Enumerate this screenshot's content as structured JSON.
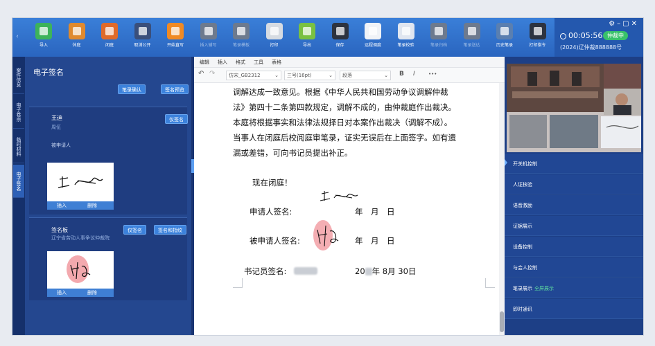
{
  "toolbar": {
    "buttons": [
      {
        "label": "导入",
        "icon": "import-icon",
        "color": "#3db35a",
        "enabled": true
      },
      {
        "label": "休庭",
        "icon": "recess-icon",
        "color": "#e08a2e",
        "enabled": true
      },
      {
        "label": "闭庭",
        "icon": "close-court-icon",
        "color": "#e06a2a",
        "enabled": true
      },
      {
        "label": "取消公开",
        "icon": "cancel-public-icon",
        "color": "#3a4f7a",
        "enabled": true
      },
      {
        "label": "开始直写",
        "icon": "start-write-icon",
        "color": "#f08a24",
        "enabled": true
      },
      {
        "label": "插入辅写",
        "icon": "insert-assist-icon",
        "color": "#6d7a8e",
        "enabled": false
      },
      {
        "label": "笔录模板",
        "icon": "transcript-template-icon",
        "color": "#6d7a8e",
        "enabled": false
      },
      {
        "label": "打印",
        "icon": "print-icon",
        "color": "#d6dbe2",
        "enabled": true
      },
      {
        "label": "导出",
        "icon": "export-icon",
        "color": "#7ac142",
        "enabled": true
      },
      {
        "label": "保存",
        "icon": "save-icon",
        "color": "#2d3340",
        "enabled": true
      },
      {
        "label": "远程调度",
        "icon": "remote-dispatch-icon",
        "color": "#f0f3f7",
        "enabled": true
      },
      {
        "label": "笔录校验",
        "icon": "transcript-check-icon",
        "color": "#e0e6f0",
        "enabled": true
      },
      {
        "label": "笔录归档",
        "icon": "transcript-archive-icon",
        "color": "#6d7a8e",
        "enabled": false
      },
      {
        "label": "笔录送达",
        "icon": "transcript-deliver-icon",
        "color": "#6d7a8e",
        "enabled": false
      },
      {
        "label": "历史笔录",
        "icon": "history-transcript-icon",
        "color": "#5a7fb0",
        "enabled": true
      },
      {
        "label": "打印指令",
        "icon": "print-command-icon",
        "color": "#2d3340",
        "enabled": true
      }
    ],
    "timer": "00:05:56",
    "status": "仲裁中",
    "case_no": "(2024)辽仲裁888888号"
  },
  "vtabs": [
    "案件信息",
    "电子卷宗",
    "临时材料",
    "电子签名"
  ],
  "left": {
    "title": "电子签名",
    "confirm_btn": "笔录确认",
    "preview_btn": "签名预览",
    "signer1": {
      "name": "王迪",
      "role": "周伍",
      "party": "被申请人",
      "sign_btn": "仅签名",
      "insert": "插入",
      "delete": "删除"
    },
    "signer2": {
      "name": "签名板",
      "org": "辽宁省劳动人事争议仲裁院",
      "sign_btn": "仅签名",
      "sign_fp_btn": "签名和指纹",
      "insert": "插入",
      "delete": "删除"
    }
  },
  "editor": {
    "menu": [
      "编辑",
      "插入",
      "格式",
      "工具",
      "表格"
    ],
    "font": "仿宋_GB2312",
    "size": "三号(16pt)",
    "para_style": "段落",
    "bold": "B",
    "italic": "I",
    "more": "•••",
    "paragraph_lines": [
      "调解达成一致意见。根据《中华人民共和国劳动争议调解仲裁",
      "法》第四十二条第四款规定，调解不成的，由仲裁庭作出裁决。",
      "本庭将根据事实和法律法规择日对本案作出裁决（调解不成）。",
      "当事人在闭庭后校阅庭审笔录，证实无误后在上面签字。如有遗",
      "漏或差错，可向书记员提出补正。"
    ],
    "closing": "现在闭庭！",
    "applicant_label": "申请人签名:",
    "respondent_label": "被申请人签名:",
    "clerk_label": "书记员签名:",
    "date_placeholder": "年　月　日",
    "clerk_date_prefix": "20",
    "clerk_date_suffix": "年 8月 30日"
  },
  "right": {
    "items": [
      "开关机控制",
      "人证核验",
      "语音激励",
      "证据展示",
      "设备控制",
      "与会人控制",
      "笔录展示",
      "即时通讯"
    ],
    "transcript_extra": "全屏展示"
  }
}
